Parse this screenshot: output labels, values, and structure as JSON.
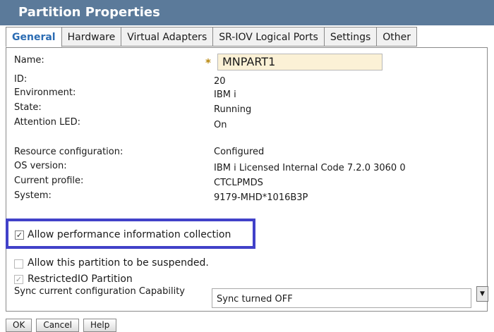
{
  "window": {
    "title": "Partition Properties"
  },
  "tabs": [
    {
      "label": "General",
      "active": true
    },
    {
      "label": "Hardware"
    },
    {
      "label": "Virtual Adapters"
    },
    {
      "label": "SR-IOV Logical Ports"
    },
    {
      "label": "Settings"
    },
    {
      "label": "Other"
    }
  ],
  "general": {
    "name_label": "Name:",
    "name_value": "MNPART1",
    "required_marker": "*",
    "id_label": "ID:",
    "id_value": "20",
    "environment_label": "Environment:",
    "environment_value": "IBM i",
    "state_label": "State:",
    "state_value": "Running",
    "attention_led_label": "Attention LED:",
    "attention_led_value": "On",
    "resource_config_label": "Resource configuration:",
    "resource_config_value": "Configured",
    "os_version_label": "OS version:",
    "os_version_value": "IBM i Licensed Internal Code 7.2.0 3060 0",
    "current_profile_label": "Current profile:",
    "current_profile_value": "CTCLPMDS",
    "system_label": "System:",
    "system_value": "9179-MHD*1016B3P"
  },
  "options": {
    "perf_collection_label": "Allow performance information collection",
    "perf_collection_checked": true,
    "suspend_label": "Allow this partition to be suspended.",
    "suspend_checked": false,
    "restricted_io_label": "RestrictedIO Partition",
    "restricted_io_checked": true,
    "sync_label": "Sync current configuration Capability",
    "sync_value": "Sync turned OFF"
  },
  "buttons": {
    "ok": "OK",
    "cancel": "Cancel",
    "help": "Help"
  },
  "colors": {
    "titlebar": "#5b7a9a",
    "active_tab_text": "#2b6cb3",
    "highlight_border": "#4141c9",
    "name_field_bg": "#fbf1d6"
  }
}
